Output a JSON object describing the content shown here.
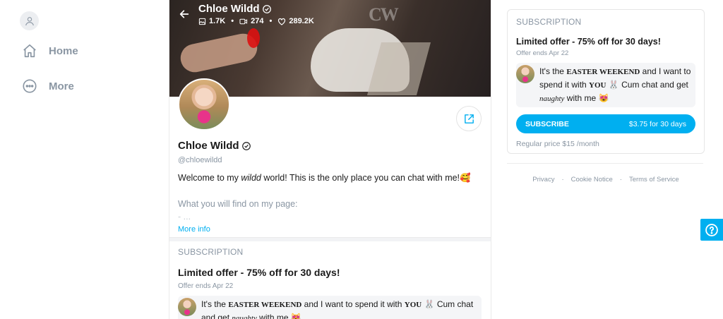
{
  "nav": {
    "items": [
      {
        "label": "Home",
        "icon": "home-icon"
      },
      {
        "label": "More",
        "icon": "more-icon"
      }
    ]
  },
  "cover": {
    "name": "Chloe Wildd",
    "stats": {
      "photos": "1.7K",
      "videos": "274",
      "likes": "289.2K"
    }
  },
  "profile": {
    "name": "Chloe Wildd",
    "handle": "@chloewildd",
    "bio_before": "Welcome to my ",
    "bio_em": "wildd",
    "bio_after": " world! This is the only place you can chat with me!🥰",
    "bio_line2": "What you will find on my page:",
    "bio_line3": "- ...",
    "more_info": "More info"
  },
  "subscription": {
    "title": "SUBSCRIPTION",
    "offer": "Limited offer - 75% off for 30 days!",
    "ends": "Offer ends Apr 22",
    "msg_1": "It's the ",
    "msg_easter": "EASTER WEEKEND",
    "msg_2": " and I want to spend it with ",
    "msg_you": "YOU",
    "msg_3": " 🐰 Cum chat and get ",
    "msg_naughty": "naughty",
    "msg_4": " with me 😻",
    "button_label": "SUBSCRIBE",
    "button_price": "$3.75 for 30 days",
    "regular": "Regular price $15 /month"
  },
  "footer": {
    "privacy": "Privacy",
    "cookie": "Cookie Notice",
    "terms": "Terms of Service"
  },
  "colors": {
    "accent": "#00aff0",
    "muted": "#8a96a3"
  }
}
